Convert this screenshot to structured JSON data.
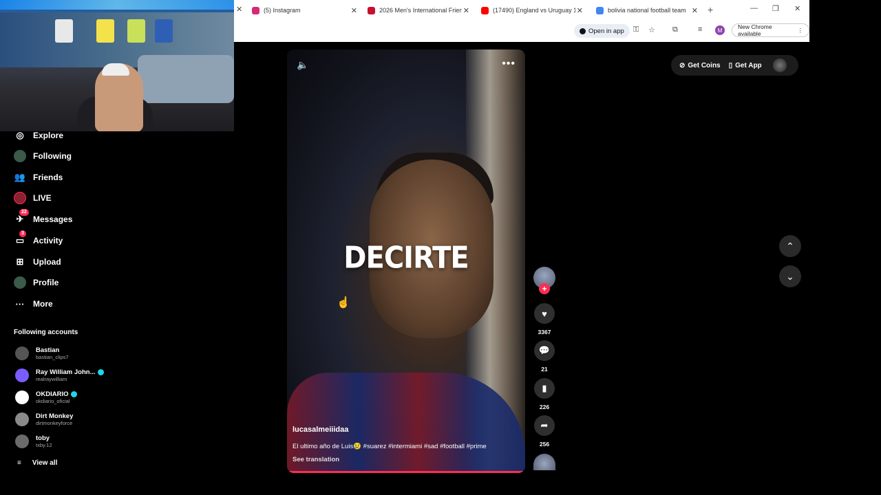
{
  "browser": {
    "tabs": [
      {
        "title": "(5) Instagram",
        "fav_color": "#d62976"
      },
      {
        "title": "2026 Men's International Frienc",
        "fav_color": "#c8102e"
      },
      {
        "title": "(17490) England vs Uruguay 1-",
        "fav_color": "#ff0000"
      },
      {
        "title": "bolivia national football team",
        "fav_color": "#4285f4"
      }
    ],
    "open_in_app": "Open in app",
    "profile_initial": "M",
    "new_chrome": "New Chrome available"
  },
  "sidebar": {
    "items": [
      {
        "label": "Explore",
        "icon": "compass-icon",
        "glyph": "◎"
      },
      {
        "label": "Following",
        "icon": "following-avatar-icon",
        "glyph": "●"
      },
      {
        "label": "Friends",
        "icon": "friends-icon",
        "glyph": "👥"
      },
      {
        "label": "LIVE",
        "icon": "live-icon",
        "glyph": "●"
      },
      {
        "label": "Messages",
        "icon": "messages-icon",
        "glyph": "✈",
        "badge": "22"
      },
      {
        "label": "Activity",
        "icon": "activity-icon",
        "glyph": "▭",
        "badge": "3"
      },
      {
        "label": "Upload",
        "icon": "upload-icon",
        "glyph": "⊞"
      },
      {
        "label": "Profile",
        "icon": "profile-avatar-icon",
        "glyph": "●"
      },
      {
        "label": "More",
        "icon": "more-icon",
        "glyph": "···"
      }
    ],
    "following_title": "Following accounts",
    "accounts": [
      {
        "name": "Bastian",
        "handle": "bastian_clips7",
        "color": "#555",
        "verified": false
      },
      {
        "name": "Ray William John...",
        "handle": "realraywilliam",
        "color": "#7a5cff",
        "verified": true
      },
      {
        "name": "OKDIARIO",
        "handle": "okdiario_oficial",
        "color": "#fff",
        "verified": true
      },
      {
        "name": "Dirt Monkey",
        "handle": "dirtmonkeyforce",
        "color": "#8a8a8a",
        "verified": false
      },
      {
        "name": "toby",
        "handle": "txby.12",
        "color": "#6b6b6b",
        "verified": false
      }
    ],
    "view_all": "View all"
  },
  "video": {
    "overlay_word": "DECIRTE",
    "username": "lucasalmeiiidaa",
    "caption": "El ultimo año de Luis😢 #suarez #intermiami #sad #football #prime",
    "see_translation": "See translation",
    "progress": 1.0
  },
  "actions": {
    "likes": "3367",
    "comments": "21",
    "saves": "226",
    "shares": "256"
  },
  "topbar": {
    "get_coins": "Get Coins",
    "get_app": "Get App"
  }
}
